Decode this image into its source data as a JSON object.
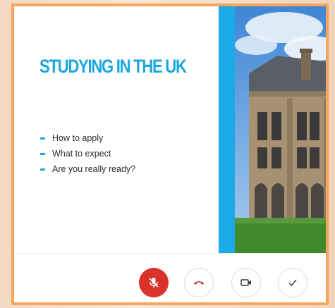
{
  "slide": {
    "title": "STUDYING IN THE UK",
    "bullets": [
      "How to apply",
      "What to expect",
      "Are you really ready?"
    ]
  },
  "controls": [
    {
      "name": "mute-mic-button",
      "icon": "mic-off-icon",
      "state": "muted"
    },
    {
      "name": "end-call-button",
      "icon": "hang-up-icon"
    },
    {
      "name": "video-button",
      "icon": "video-camera-icon"
    },
    {
      "name": "check-button",
      "icon": "checkmark-icon"
    }
  ],
  "colors": {
    "accent": "#1aa7e0",
    "frame_border": "#f5a55c",
    "mic_button": "#d9332c",
    "hangup_icon": "#c62828"
  }
}
